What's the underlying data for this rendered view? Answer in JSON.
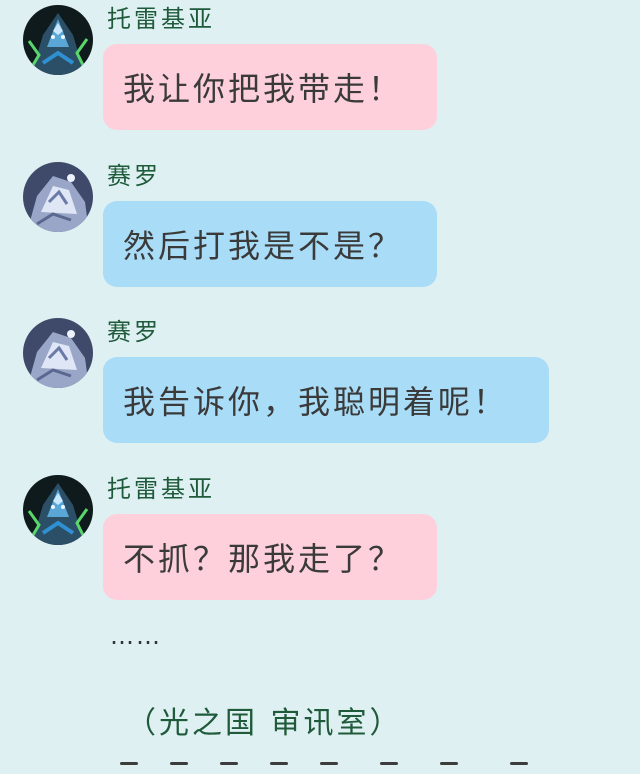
{
  "messages": [
    {
      "sender": "托雷基亚",
      "text": "我让你把我带走！",
      "avatar": "troikia-avatar",
      "bubble_color": "#fdd0dc"
    },
    {
      "sender": "赛罗",
      "text": "然后打我是不是？",
      "avatar": "zero-avatar",
      "bubble_color": "#a9dcf7"
    },
    {
      "sender": "赛罗",
      "text": "我告诉你，我聪明着呢！",
      "avatar": "zero-avatar",
      "bubble_color": "#a9dcf7"
    },
    {
      "sender": "托雷基亚",
      "text": "不抓？那我走了？",
      "avatar": "troikia-avatar",
      "bubble_color": "#fdd0dc"
    }
  ],
  "ellipsis": "……",
  "scene_note": "（光之国 审讯室）",
  "colors": {
    "background": "#def0f2",
    "name_text": "#1f5a3a",
    "pink_bubble": "#fdd0dc",
    "blue_bubble": "#a9dcf7"
  }
}
